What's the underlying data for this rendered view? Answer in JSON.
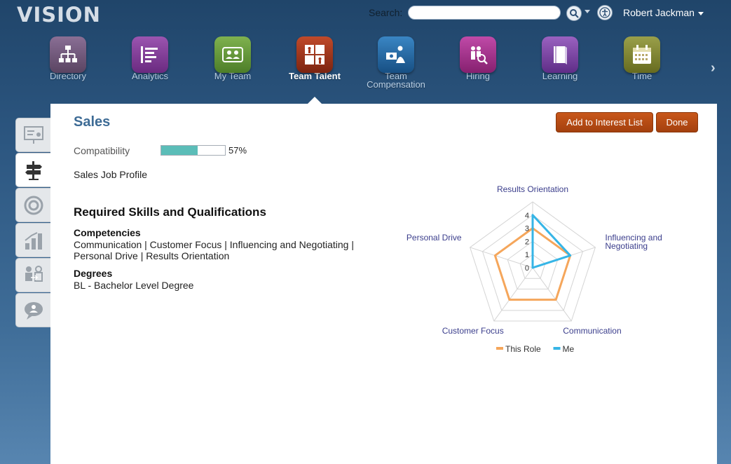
{
  "header": {
    "logo": "VISION",
    "search_label": "Search:",
    "search_value": "",
    "user_name": "Robert Jackman"
  },
  "nav": {
    "items": [
      {
        "label": "Directory",
        "icon": "org-chart-icon",
        "color": "#6e5877"
      },
      {
        "label": "Analytics",
        "icon": "analytics-icon",
        "color": "#7a3a8f"
      },
      {
        "label": "My Team",
        "icon": "team-icon",
        "color": "#5a8e3a"
      },
      {
        "label": "Team Talent",
        "icon": "talent-icon",
        "color": "#9a3218",
        "active": true
      },
      {
        "label": "Team Compensation",
        "label_line1": "Team",
        "label_line2": "Compensation",
        "icon": "compensation-icon",
        "color": "#1f6aa8"
      },
      {
        "label": "Hiring",
        "icon": "hiring-icon",
        "color": "#a8328f"
      },
      {
        "label": "Learning",
        "icon": "book-icon",
        "color": "#7d43a3"
      },
      {
        "label": "Time",
        "icon": "calendar-icon",
        "color": "#7c7e2c"
      }
    ],
    "next_icon": "chevron-right-icon"
  },
  "side_tabs": [
    {
      "icon": "presentation-icon"
    },
    {
      "icon": "signpost-icon",
      "active": true
    },
    {
      "icon": "target-icon"
    },
    {
      "icon": "bar-chart-icon"
    },
    {
      "icon": "people-transfer-icon"
    },
    {
      "icon": "chat-bubble-icon"
    }
  ],
  "content": {
    "title": "Sales",
    "add_button": "Add to Interest List",
    "done_button": "Done",
    "compatibility_label": "Compatibility",
    "compatibility_value": 57,
    "compatibility_text": "57%",
    "profile_text": "Sales Job Profile",
    "req_title": "Required Skills and Qualifications",
    "competencies_heading": "Competencies",
    "competencies_line1": "Communication | Customer Focus | Influencing and Negotiating |",
    "competencies_line2": "Personal Drive | Results Orientation",
    "degrees_heading": "Degrees",
    "degrees_text": "BL - Bachelor Level Degree"
  },
  "chart_data": {
    "type": "radar",
    "axes": [
      "Results Orientation",
      "Influencing and Negotiating",
      "Communication",
      "Customer Focus",
      "Personal Drive"
    ],
    "axis_label_lines": [
      [
        "Results Orientation"
      ],
      [
        "Influencing and",
        "Negotiating"
      ],
      [
        "Communication"
      ],
      [
        "Customer Focus"
      ],
      [
        "Personal Drive"
      ]
    ],
    "ticks": [
      "0",
      "1",
      "2",
      "3",
      "4"
    ],
    "rmax": 5,
    "series": [
      {
        "name": "This Role",
        "values": [
          3,
          3,
          3,
          3,
          3
        ],
        "color": "#f5a65b"
      },
      {
        "name": "Me",
        "values": [
          4,
          3,
          0,
          0,
          0
        ],
        "color": "#36b5e6"
      }
    ],
    "legend": "bottom"
  }
}
